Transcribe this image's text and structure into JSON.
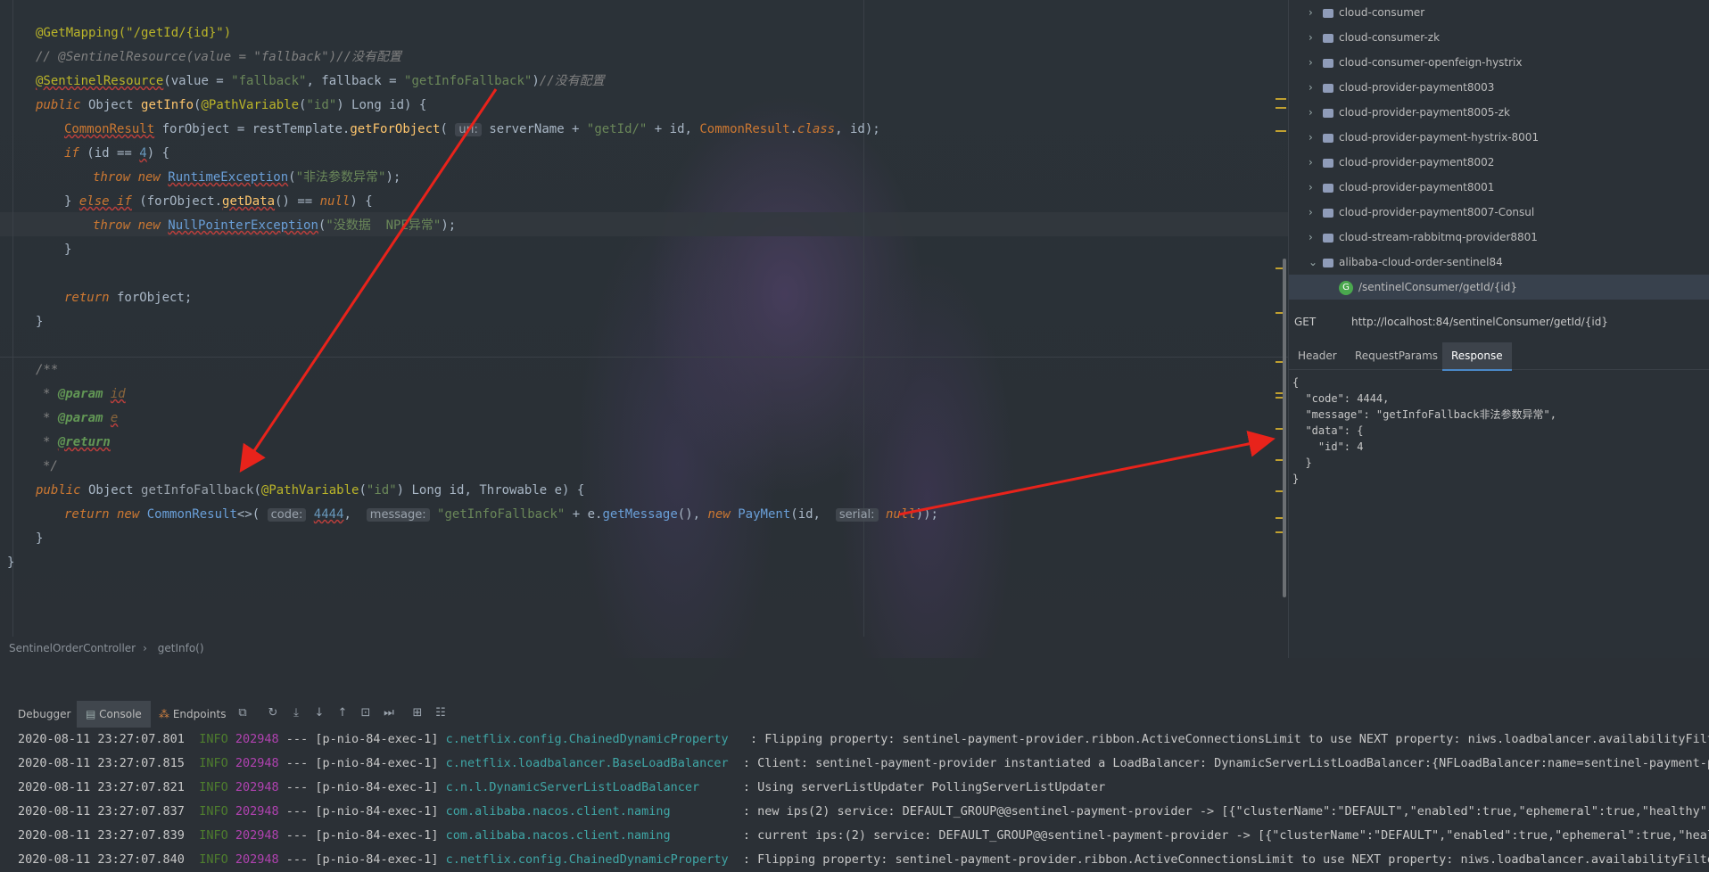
{
  "editor": {
    "breadcrumb": [
      "SentinelOrderController",
      "getInfo()"
    ],
    "lines": {
      "l1_ann": "@GetMapping(\"/getId/{id}\")",
      "l2_comment": "// @SentinelResource(value = \"fallback\")//没有配置",
      "l3_ann": "@SentinelResource",
      "l3_args_a": "(value = ",
      "l3_str1": "\"fallback\"",
      "l3_args_b": ", fallback = ",
      "l3_str2": "\"getInfoFallback\"",
      "l3_close": ")",
      "l3_comment": "//没有配置",
      "l4_kw": "public",
      "l4_type": " Object ",
      "l4_fn": "getInfo",
      "l4_rest_a": "(",
      "l4_ann": "@PathVariable",
      "l4_rest_b": "(",
      "l4_str": "\"id\"",
      "l4_rest_c": ") Long id) {",
      "l5_cls": "CommonResult",
      "l5_a": " forObject = restTemplate.",
      "l5_fn": "getForObject",
      "l5_b": "( ",
      "l5_hint": "url:",
      "l5_c": " serverName + ",
      "l5_str": "\"getId/\"",
      "l5_d": " + id, ",
      "l5_cls2": "CommonResult",
      "l5_e": ".",
      "l5_kw": "class",
      "l5_f": ", id);",
      "l6_kw": "if",
      "l6_a": " (id == ",
      "l6_num": "4",
      "l6_b": ") {",
      "l7_kw": "throw new",
      "l7_cls": "RuntimeException",
      "l7_a": "(",
      "l7_str": "\"非法参数异常\"",
      "l7_b": ");",
      "l8_a": "} ",
      "l8_kw": "else if",
      "l8_b": " (forObject.",
      "l8_fn": "getData",
      "l8_c": "() == ",
      "l8_kw2": "null",
      "l8_d": ") {",
      "l9_kw": "throw new",
      "l9_cls": "NullPointerException",
      "l9_a": "(",
      "l9_str": "\"没数据  NPE异常\"",
      "l9_b": ");",
      "l10": "}",
      "l12_kw": "return",
      "l12_a": " forObject;",
      "l13": "}",
      "l15": "/**",
      "l16_tag": "@param",
      "l16_p": "id",
      "l17_tag": "@param",
      "l17_p": "e",
      "l18_tag": "@return",
      "l19": "*/",
      "l20_kw": "public",
      "l20_type": " Object ",
      "l20_fn": "getInfoFallback",
      "l20_a": "(",
      "l20_ann": "@PathVariable",
      "l20_b": "(",
      "l20_str": "\"id\"",
      "l20_c": ") Long id, Throwable e) {",
      "l21_kw": "return new",
      "l21_cls": "CommonResult",
      "l21_a": "<>( ",
      "l21_hint1": "code:",
      "l21_num": "4444",
      "l21_b": ",  ",
      "l21_hint2": "message:",
      "l21_str": "\"getInfoFallback\"",
      "l21_c": " + e.",
      "l21_fn": "getMessage",
      "l21_d": "(), ",
      "l21_kw2": "new",
      "l21_cls2": "PayMent",
      "l21_e": "(id,  ",
      "l21_hint3": "serial:",
      "l21_kw3": "null",
      "l21_f": "));",
      "l22": "}",
      "l23": "}"
    }
  },
  "project_tree": {
    "items": [
      "cloud-consumer",
      "cloud-consumer-zk",
      "cloud-consumer-openfeign-hystrix",
      "cloud-provider-payment8003",
      "cloud-provider-payment8005-zk",
      "cloud-provider-payment-hystrix-8001",
      "cloud-provider-payment8002",
      "cloud-provider-payment8001",
      "cloud-provider-payment8007-Consul",
      "cloud-stream-rabbitmq-provider8801",
      "alibaba-cloud-order-sentinel84"
    ],
    "endpoint_icon": "G",
    "endpoint": "/sentinelConsumer/getId/{id}"
  },
  "request": {
    "method": "GET",
    "url": "http://localhost:84/sentinelConsumer/getId/{id}",
    "tabs": [
      "Header",
      "RequestParams",
      "Response"
    ],
    "active_tab": "Response",
    "response_lines": [
      "{",
      "  \"code\": 4444,",
      "  \"message\": \"getInfoFallback非法参数异常\",",
      "  \"data\": {",
      "    \"id\": 4",
      "  }",
      "}"
    ]
  },
  "bottom_panel": {
    "tabs": [
      "Debugger",
      "Console",
      "Endpoints"
    ],
    "active_tab": "Console",
    "logs": [
      {
        "ts": "2020-08-11 23:27:07.801",
        "level": "INFO",
        "pid": "202948",
        "sep": "---",
        "thread": "[p-nio-84-exec-1]",
        "logger": "c.netflix.config.ChainedDynamicProperty",
        "msg": ": Flipping property: sentinel-payment-provider.ribbon.ActiveConnectionsLimit to use NEXT property: niws.loadbalancer.availabilityFiltering"
      },
      {
        "ts": "2020-08-11 23:27:07.815",
        "level": "INFO",
        "pid": "202948",
        "sep": "---",
        "thread": "[p-nio-84-exec-1]",
        "logger": "c.netflix.loadbalancer.BaseLoadBalancer",
        "msg": ": Client: sentinel-payment-provider instantiated a LoadBalancer: DynamicServerListLoadBalancer:{NFLoadBalancer:name=sentinel-payment-prov"
      },
      {
        "ts": "2020-08-11 23:27:07.821",
        "level": "INFO",
        "pid": "202948",
        "sep": "---",
        "thread": "[p-nio-84-exec-1]",
        "logger": "c.n.l.DynamicServerListLoadBalancer",
        "msg": ": Using serverListUpdater PollingServerListUpdater"
      },
      {
        "ts": "2020-08-11 23:27:07.837",
        "level": "INFO",
        "pid": "202948",
        "sep": "---",
        "thread": "[p-nio-84-exec-1]",
        "logger": "com.alibaba.nacos.client.naming",
        "msg": ": new ips(2) service: DEFAULT_GROUP@@sentinel-payment-provider -> [{\"clusterName\":\"DEFAULT\",\"enabled\":true,\"ephemeral\":true,\"healthy\":tru"
      },
      {
        "ts": "2020-08-11 23:27:07.839",
        "level": "INFO",
        "pid": "202948",
        "sep": "---",
        "thread": "[p-nio-84-exec-1]",
        "logger": "com.alibaba.nacos.client.naming",
        "msg": ": current ips:(2) service: DEFAULT_GROUP@@sentinel-payment-provider -> [{\"clusterName\":\"DEFAULT\",\"enabled\":true,\"ephemeral\":true,\"health"
      },
      {
        "ts": "2020-08-11 23:27:07.840",
        "level": "INFO",
        "pid": "202948",
        "sep": "---",
        "thread": "[p-nio-84-exec-1]",
        "logger": "c.netflix.config.ChainedDynamicProperty",
        "msg": ": Flipping property: sentinel-payment-provider.ribbon.ActiveConnectionsLimit to use NEXT property: niws.loadbalancer.availabilityFilteri"
      }
    ]
  },
  "colors": {
    "annotation": "#bbb529",
    "keyword": "#cc7832",
    "string": "#6a8759",
    "arrow": "#e8231b"
  }
}
